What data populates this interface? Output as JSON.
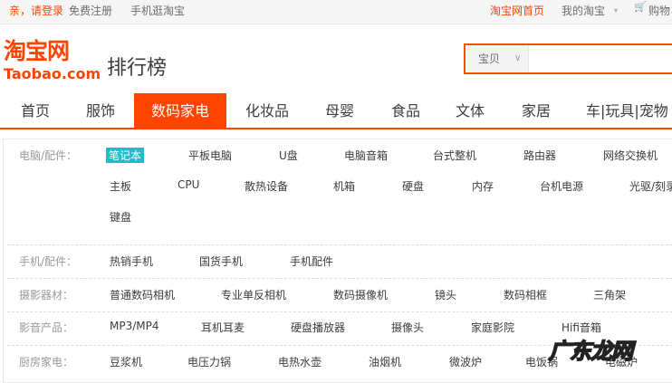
{
  "topbar": {
    "login": "亲，请登录",
    "register": "免费注册",
    "mobile": "手机逛淘宝",
    "home": "淘宝网首页",
    "my_taobao": "我的淘宝",
    "cart": "购物"
  },
  "logo": {
    "cn": "淘宝网",
    "en": "Taobao.com"
  },
  "page_title": "排行榜",
  "search": {
    "scope": "宝贝",
    "value": ""
  },
  "nav": [
    "首页",
    "服饰",
    "数码家电",
    "化妆品",
    "母婴",
    "食品",
    "文体",
    "家居",
    "车|玩具|宠物"
  ],
  "categories": [
    {
      "label": "电脑/配件：",
      "items": [
        "笔记本",
        "平板电脑",
        "U盘",
        "电脑音箱",
        "台式整机",
        "路由器",
        "网络交换机",
        "主板",
        "CPU",
        "散热设备",
        "机箱",
        "硬盘",
        "内存",
        "台机电源",
        "光驱/刻录",
        "键盘"
      ]
    },
    {
      "label": "手机/配件：",
      "items": [
        "热销手机",
        "国货手机",
        "手机配件"
      ]
    },
    {
      "label": "摄影器材：",
      "items": [
        "普通数码相机",
        "专业单反相机",
        "数码摄像机",
        "镜头",
        "数码相框",
        "三角架"
      ]
    },
    {
      "label": "影音产品：",
      "items": [
        "MP3/MP4",
        "耳机耳麦",
        "硬盘播放器",
        "摄像头",
        "家庭影院",
        "Hifi音箱"
      ]
    },
    {
      "label": "厨房家电：",
      "items": [
        "豆浆机",
        "电压力锅",
        "电热水壶",
        "油烟机",
        "微波炉",
        "电饭锅",
        "电磁炉"
      ]
    }
  ],
  "watermark": "广东龙网"
}
